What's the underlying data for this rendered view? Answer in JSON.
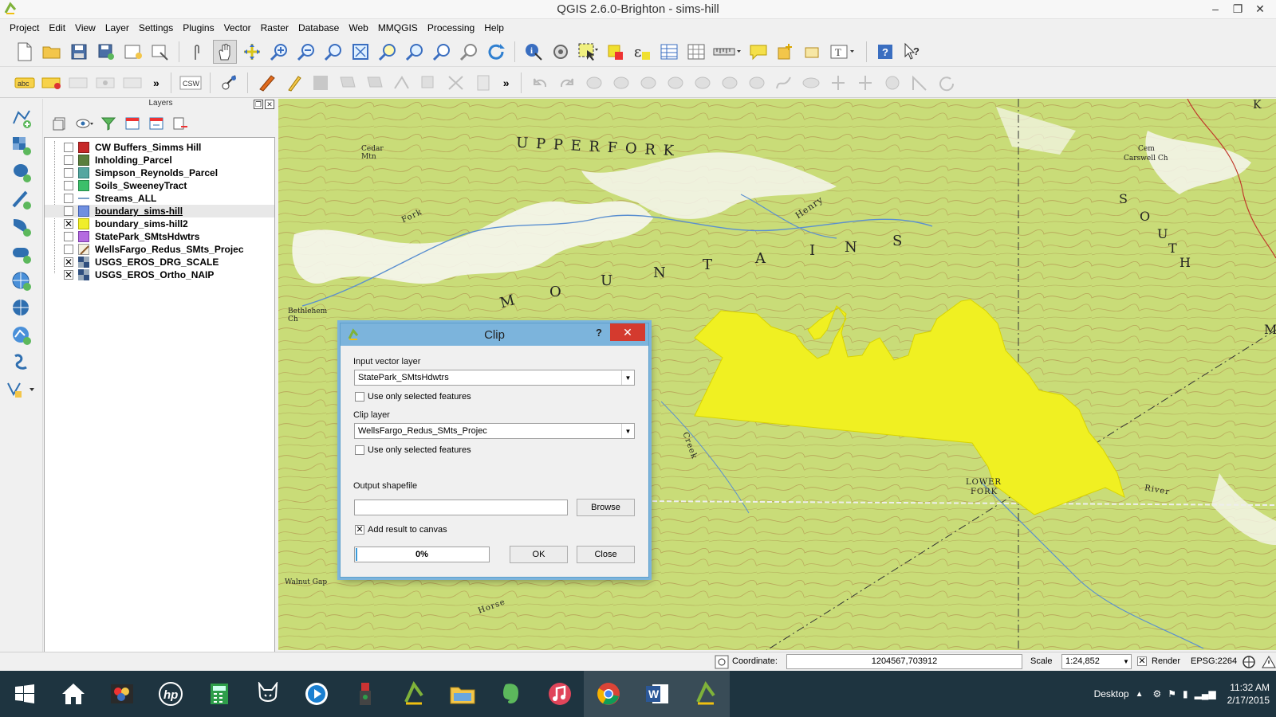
{
  "window": {
    "title": "QGIS 2.6.0-Brighton - sims-hill",
    "controls": [
      "minimize",
      "restore",
      "close"
    ]
  },
  "menubar": [
    "Project",
    "Edit",
    "View",
    "Layer",
    "Settings",
    "Plugins",
    "Vector",
    "Raster",
    "Database",
    "Web",
    "MMQGIS",
    "Processing",
    "Help"
  ],
  "toolbar2": {
    "label_tool_text": "abc",
    "csw_label": "CSW"
  },
  "layers_panel": {
    "title": "Layers",
    "layers": [
      {
        "name": "CW Buffers_Simms Hill",
        "checked": false,
        "swatch": "#c62828"
      },
      {
        "name": "Inholding_Parcel",
        "checked": false,
        "swatch": "#5a7f3d"
      },
      {
        "name": "Simpson_Reynolds_Parcel",
        "checked": false,
        "swatch": "#55a6a0"
      },
      {
        "name": "Soils_SweeneyTract",
        "checked": false,
        "swatch": "#3cbf6a"
      },
      {
        "name": "Streams_ALL",
        "checked": false,
        "swatch": "line"
      },
      {
        "name": "boundary_sims-hill",
        "checked": false,
        "swatch": "#6f8fe0",
        "selected": true
      },
      {
        "name": "boundary_sims-hill2",
        "checked": true,
        "swatch": "#f0ee2a"
      },
      {
        "name": "StatePark_SMtsHdwtrs",
        "checked": false,
        "swatch": "#b46be0"
      },
      {
        "name": "WellsFargo_Redus_SMts_Projec",
        "checked": false,
        "swatch": "line-diag"
      },
      {
        "name": "USGS_EROS_DRG_SCALE",
        "checked": true,
        "swatch": "raster"
      },
      {
        "name": "USGS_EROS_Ortho_NAIP",
        "checked": true,
        "swatch": "raster"
      }
    ]
  },
  "map": {
    "labels": {
      "upper_fork": "U P P E R   F O R K",
      "mountains_m": "M",
      "mountains_o": "O",
      "mountains_u": "U",
      "mountains_n": "N",
      "mountains_t": "T",
      "mountains_a": "A",
      "mountains_i": "I",
      "mountains_n2": "N",
      "mountains_s": "S",
      "south_s": "S",
      "south_o": "O",
      "south_u": "U",
      "south_t": "T",
      "south_h": "H",
      "cedar": "Cedar",
      "mtn": "Mtn",
      "cemetery": "Cem",
      "carswell": "Carswell Ch",
      "bethlehem": "Bethlehem",
      "bethlehem_ch": "Ch",
      "henry": "Henry",
      "fork": "Fork",
      "lower_fork": "LOWER",
      "lower_fork2": "FORK",
      "river": "River",
      "walnut_gap": "Walnut Gap",
      "horse": "Horse",
      "creek": "Creek",
      "edge_m": "M",
      "edge_k": "K"
    },
    "polygon_color": "#f0f022"
  },
  "clip_dialog": {
    "title": "Clip",
    "help": "?",
    "close": "✕",
    "input_label": "Input vector layer",
    "input_value": "StatePark_SMtsHdwtrs",
    "use_selected_1": "Use only selected features",
    "clip_label": "Clip layer",
    "clip_value": "WellsFargo_Redus_SMts_Projec",
    "use_selected_2": "Use only selected features",
    "output_label": "Output shapefile",
    "output_value": "",
    "browse": "Browse",
    "add_result": "Add result to canvas",
    "add_result_checked": true,
    "progress_text": "0%",
    "progress": 0,
    "ok": "OK",
    "close_btn": "Close"
  },
  "statusbar": {
    "coordinate_label": "Coordinate:",
    "coordinate_value": "1204567,703912",
    "scale_label": "Scale",
    "scale_value": "1:24,852",
    "render_label": "Render",
    "render_checked": true,
    "crs": "EPSG:2264"
  },
  "taskbar": {
    "apps": [
      "windows-start",
      "home",
      "photo-app",
      "hp",
      "calculator",
      "cat-app",
      "media-player",
      "usb-app",
      "qgis-1",
      "file-explorer",
      "evernote",
      "itunes",
      "chrome",
      "word",
      "qgis-2"
    ],
    "desktop_label": "Desktop",
    "time": "11:32 AM",
    "date": "2/17/2015"
  }
}
